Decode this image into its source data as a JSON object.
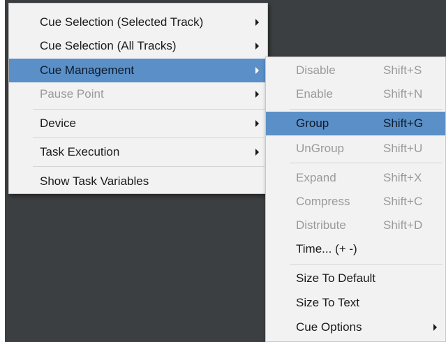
{
  "main_menu": {
    "items": [
      {
        "label": "Cue Selection (Selected Track)",
        "submenu": true,
        "state": "normal"
      },
      {
        "label": "Cue Selection (All Tracks)",
        "submenu": true,
        "state": "normal"
      },
      {
        "label": "Cue Management",
        "submenu": true,
        "state": "highlighted"
      },
      {
        "label": "Pause Point",
        "submenu": true,
        "state": "disabled"
      },
      {
        "label": "Device",
        "submenu": true,
        "state": "normal"
      },
      {
        "label": "Task Execution",
        "submenu": true,
        "state": "normal"
      },
      {
        "label": "Show Task Variables",
        "submenu": false,
        "state": "normal"
      }
    ]
  },
  "cue_management_submenu": {
    "items": [
      {
        "label": "Disable",
        "shortcut": "Shift+S",
        "state": "disabled"
      },
      {
        "label": "Enable",
        "shortcut": "Shift+N",
        "state": "disabled"
      },
      {
        "label": "Group",
        "shortcut": "Shift+G",
        "state": "highlighted"
      },
      {
        "label": "UnGroup",
        "shortcut": "Shift+U",
        "state": "disabled"
      },
      {
        "label": "Expand",
        "shortcut": "Shift+X",
        "state": "disabled"
      },
      {
        "label": "Compress",
        "shortcut": "Shift+C",
        "state": "disabled"
      },
      {
        "label": "Distribute",
        "shortcut": "Shift+D",
        "state": "disabled"
      },
      {
        "label": "Time... (+ -)",
        "shortcut": "",
        "state": "normal"
      },
      {
        "label": "Size To Default",
        "shortcut": "",
        "state": "normal"
      },
      {
        "label": "Size To Text",
        "shortcut": "",
        "state": "normal"
      },
      {
        "label": "Cue Options",
        "shortcut": "",
        "state": "normal",
        "submenu": true
      }
    ]
  },
  "colors": {
    "highlight": "#5a8fc7",
    "menu_background": "#f2f2f2",
    "disabled_text": "#9a9a9a",
    "window_background": "#3c3f41"
  }
}
